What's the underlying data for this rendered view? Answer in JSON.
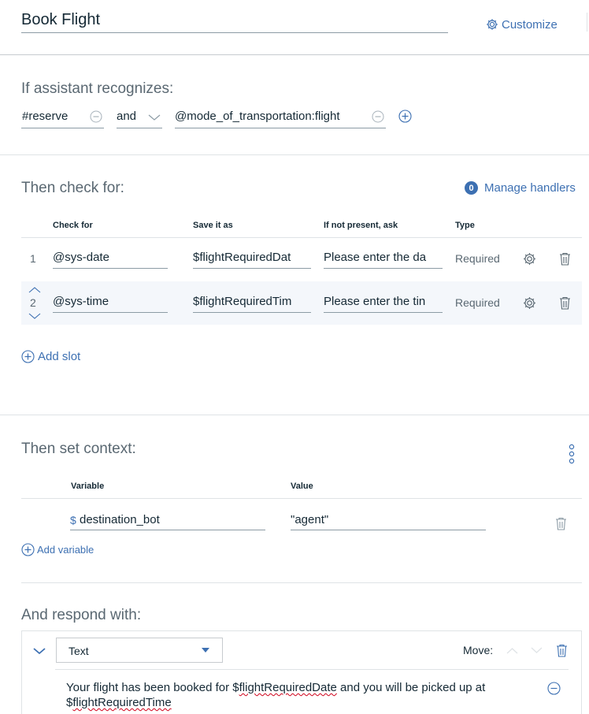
{
  "node": {
    "title": "Book Flight",
    "customize_label": "Customize"
  },
  "recognizes": {
    "heading": "If assistant recognizes:",
    "condition1": "#reserve",
    "operator": "and",
    "condition2": "@mode_of_transportation:flight"
  },
  "check": {
    "heading": "Then check for:",
    "handlers_count": "0",
    "handlers_label": "Manage handlers",
    "columns": {
      "check_for": "Check for",
      "save_as": "Save it as",
      "ask": "If not present, ask",
      "type": "Type"
    },
    "slots": [
      {
        "num": "1",
        "check_for": "@sys-date",
        "save_as": "$flightRequiredDat",
        "ask": "Please enter the da",
        "type": "Required"
      },
      {
        "num": "2",
        "check_for": "@sys-time",
        "save_as": "$flightRequiredTim",
        "ask": "Please enter the tin",
        "type": "Required"
      }
    ],
    "add_slot_label": "Add slot"
  },
  "context": {
    "heading": "Then set context:",
    "columns": {
      "variable": "Variable",
      "value": "Value"
    },
    "rows": [
      {
        "prefix": "$",
        "variable": "destination_bot",
        "value": "\"agent\""
      }
    ],
    "add_variable_label": "Add variable"
  },
  "respond": {
    "heading": "And respond with:",
    "type_selected": "Text",
    "move_label": "Move:",
    "text_part1": "Your flight has been booked for $",
    "text_var1": "flightRequiredDate",
    "text_part2": " and you will be picked up at",
    "text_part3": "$",
    "text_var2": "flightRequiredTime"
  },
  "colors": {
    "accent": "#3d70b2",
    "text": "#152935",
    "muted": "#5a6872",
    "divider": "#dfe3e6",
    "row_alt": "#f4f7fb"
  }
}
